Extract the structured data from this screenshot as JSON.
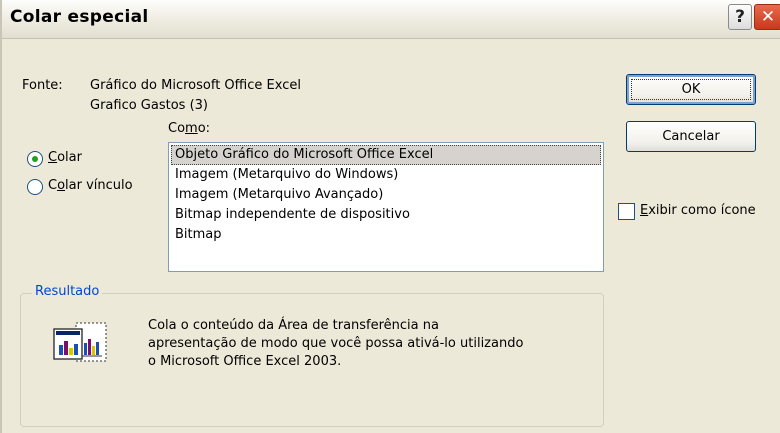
{
  "dialog": {
    "title": "Colar especial",
    "help_glyph": "?",
    "close_glyph": "✕"
  },
  "source": {
    "label": "Fonte:",
    "line1": "Gráfico do Microsoft Office Excel",
    "line2": "Grafico Gastos (3)"
  },
  "como": {
    "prefix": "Co",
    "accel": "m",
    "suffix": "o:"
  },
  "options": {
    "paste": {
      "accel": "C",
      "rest": "olar",
      "checked": true
    },
    "paste_link": {
      "pre": "C",
      "accel": "o",
      "rest": "lar vínculo",
      "checked": false
    }
  },
  "list": {
    "items": [
      "Objeto Gráfico do Microsoft Office Excel",
      "Imagem (Metarquivo do Windows)",
      "Imagem (Metarquivo Avançado)",
      "Bitmap independente de dispositivo",
      "Bitmap"
    ],
    "selected_index": 0
  },
  "buttons": {
    "ok": "OK",
    "cancel": "Cancelar"
  },
  "display_as_icon": {
    "accel": "E",
    "rest": "xibir como ícone",
    "checked": false
  },
  "result": {
    "legend": "Resultado",
    "lines": [
      "Cola o conteúdo da Área de transferência na",
      "apresentação de modo que você possa ativá-lo utilizando",
      "o Microsoft Office Excel 2003."
    ],
    "icon": "paste-chart-icon"
  },
  "colors": {
    "accent": "#0046d5",
    "close": "#c7391c",
    "dialog_bg": "#ece9d8"
  }
}
